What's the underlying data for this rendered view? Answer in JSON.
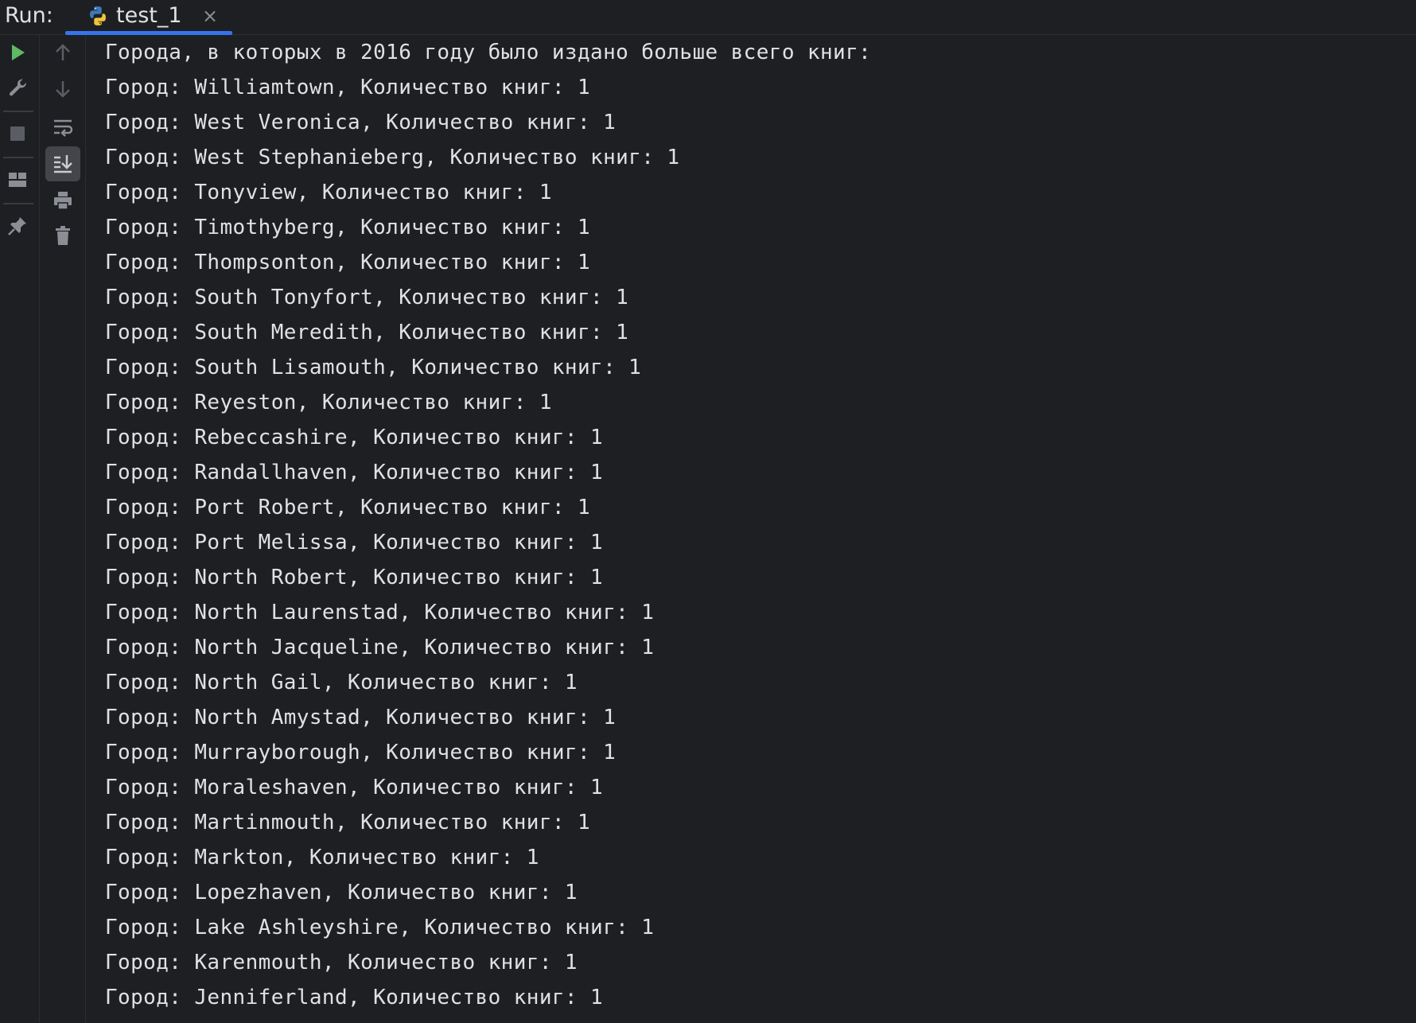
{
  "run_panel": {
    "label": "Run:",
    "tab": {
      "title": "test_1",
      "icon": "python-icon",
      "close_icon": "close-icon",
      "close_glyph": "×"
    }
  },
  "toolbar_left": [
    {
      "name": "run-icon",
      "color": "#5fb865"
    },
    {
      "name": "wrench-icon"
    },
    {
      "name": "stop-icon"
    },
    {
      "name": "layout-icon"
    },
    {
      "name": "pin-icon"
    }
  ],
  "toolbar_second": [
    {
      "name": "arrow-up-icon"
    },
    {
      "name": "arrow-down-icon"
    },
    {
      "name": "soft-wrap-icon"
    },
    {
      "name": "scroll-to-end-icon",
      "active": true
    },
    {
      "name": "print-icon"
    },
    {
      "name": "trash-icon"
    }
  ],
  "console": {
    "lines": [
      "Города, в которых в 2016 году было издано больше всего книг:",
      "Город: Williamtown, Количество книг: 1",
      "Город: West Veronica, Количество книг: 1",
      "Город: West Stephanieberg, Количество книг: 1",
      "Город: Tonyview, Количество книг: 1",
      "Город: Timothyberg, Количество книг: 1",
      "Город: Thompsonton, Количество книг: 1",
      "Город: South Tonyfort, Количество книг: 1",
      "Город: South Meredith, Количество книг: 1",
      "Город: South Lisamouth, Количество книг: 1",
      "Город: Reyeston, Количество книг: 1",
      "Город: Rebeccashire, Количество книг: 1",
      "Город: Randallhaven, Количество книг: 1",
      "Город: Port Robert, Количество книг: 1",
      "Город: Port Melissa, Количество книг: 1",
      "Город: North Robert, Количество книг: 1",
      "Город: North Laurenstad, Количество книг: 1",
      "Город: North Jacqueline, Количество книг: 1",
      "Город: North Gail, Количество книг: 1",
      "Город: North Amystad, Количество книг: 1",
      "Город: Murrayborough, Количество книг: 1",
      "Город: Moraleshaven, Количество книг: 1",
      "Город: Martinmouth, Количество книг: 1",
      "Город: Markton, Количество книг: 1",
      "Город: Lopezhaven, Количество книг: 1",
      "Город: Lake Ashleyshire, Количество книг: 1",
      "Город: Karenmouth, Количество книг: 1",
      "Город: Jenniferland, Количество книг: 1"
    ]
  },
  "colors": {
    "background": "#1e1f22",
    "text": "#dfe1e5",
    "tab_underline": "#3574f0",
    "icon_gray": "#8b8e94"
  }
}
